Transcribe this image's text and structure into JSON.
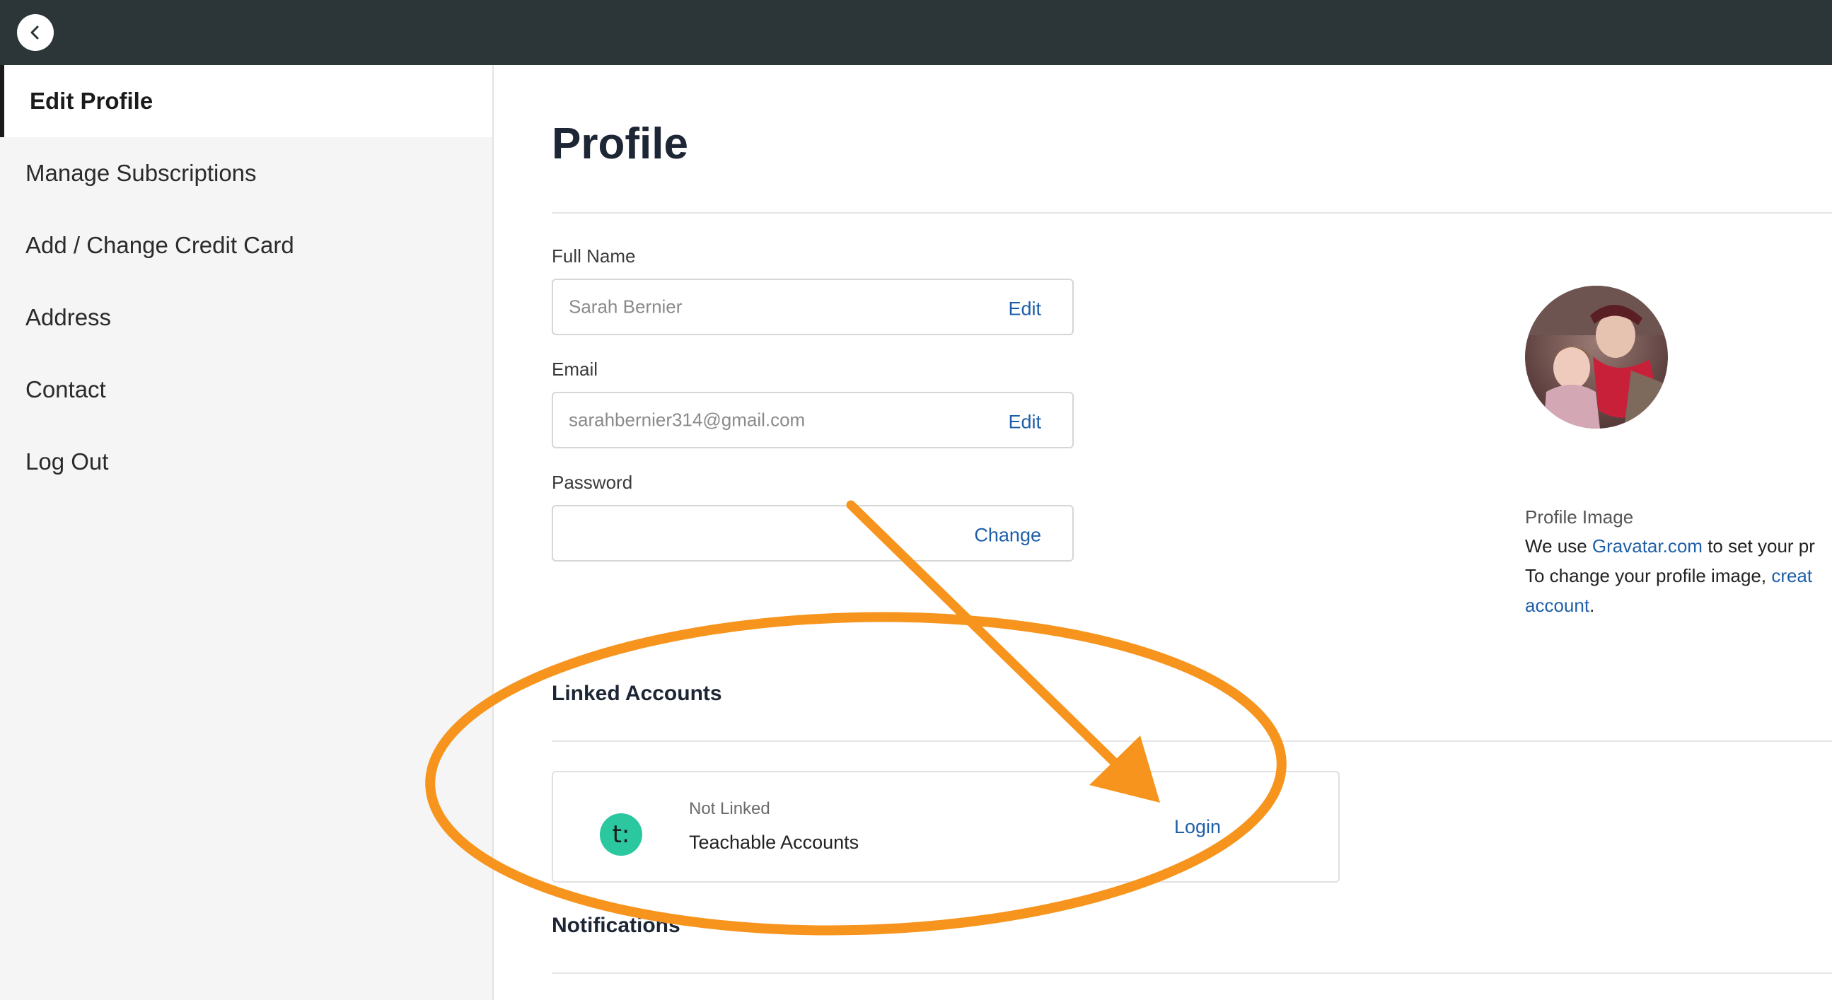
{
  "topbar": {
    "back_icon": "chevron-left-icon"
  },
  "sidebar": {
    "items": [
      {
        "label": "Edit Profile",
        "active": true
      },
      {
        "label": "Manage Subscriptions",
        "active": false
      },
      {
        "label": "Add / Change Credit Card",
        "active": false
      },
      {
        "label": "Address",
        "active": false
      },
      {
        "label": "Contact",
        "active": false
      },
      {
        "label": "Log Out",
        "active": false
      }
    ]
  },
  "main": {
    "title": "Profile",
    "fields": {
      "full_name": {
        "label": "Full Name",
        "value": "Sarah Bernier",
        "action": "Edit"
      },
      "email": {
        "label": "Email",
        "value": "sarahbernier314@gmail.com",
        "action": "Edit"
      },
      "password": {
        "label": "Password",
        "value": "",
        "action": "Change"
      }
    },
    "linked_accounts": {
      "heading": "Linked Accounts",
      "items": [
        {
          "status": "Not Linked",
          "name": "Teachable Accounts",
          "action": "Login",
          "logo_text": "t:"
        }
      ]
    },
    "notifications": {
      "heading": "Notifications"
    }
  },
  "profile_image": {
    "label": "Profile Image",
    "line1_prefix": "We use ",
    "line1_link": "Gravatar.com",
    "line1_suffix": " to set your pr",
    "line2_prefix": "To change your profile image, ",
    "line2_link": "creat",
    "line3_link": "account",
    "line3_suffix": "."
  },
  "colors": {
    "topbar": "#2c3538",
    "link": "#1f5fa8",
    "annotation": "#f7941d",
    "teachable_green": "#2bc79f"
  }
}
